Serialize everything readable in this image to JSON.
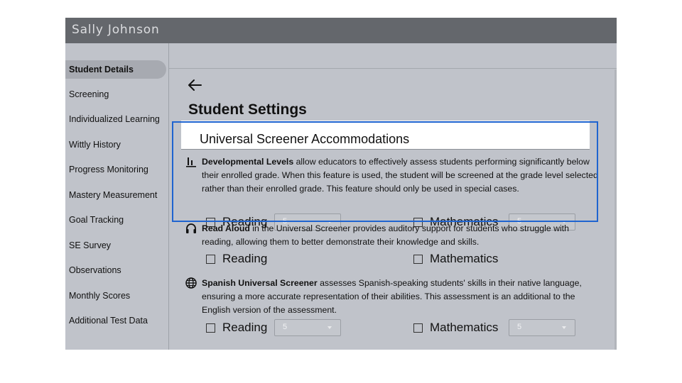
{
  "header": {
    "user_name": "Sally Johnson"
  },
  "sidebar": {
    "items": [
      {
        "label": "Student Details",
        "active": true
      },
      {
        "label": "Screening"
      },
      {
        "label": "Individualized Learning"
      },
      {
        "label": "Wittly History"
      },
      {
        "label": "Progress Monitoring"
      },
      {
        "label": "Mastery Measurement"
      },
      {
        "label": "Goal Tracking"
      },
      {
        "label": "SE Survey"
      },
      {
        "label": "Observations"
      },
      {
        "label": "Monthly Scores"
      },
      {
        "label": "Additional Test Data"
      }
    ]
  },
  "page": {
    "back_icon": "arrow-left-icon",
    "title": "Student Settings",
    "section_title": "Universal Screener Accommodations"
  },
  "accommodations": {
    "developmental": {
      "icon": "developmental-levels-icon",
      "name": "Developmental Levels",
      "text": " allow educators to effectively assess students performing significantly below their enrolled grade. When this feature is used, the student will be screened at the grade level selected rather than their enrolled grade. This feature should only be used in special cases.",
      "reading_label": "Reading",
      "reading_level": "5",
      "math_label": "Mathematics",
      "math_level": "5"
    },
    "read_aloud": {
      "icon": "headphones-icon",
      "name": "Read Aloud",
      "text": " in the Universal Screener provides auditory support for students who struggle with reading, allowing them to better demonstrate their knowledge and skills.",
      "reading_label": "Reading",
      "math_label": "Mathematics"
    },
    "spanish": {
      "icon": "globe-icon",
      "name": "Spanish Universal Screener",
      "text": " assesses Spanish-speaking students' skills in their native language, ensuring a more accurate representation of their abilities. This assessment is an additional to the English version of the assessment.",
      "reading_label": "Reading",
      "reading_level": "5",
      "math_label": "Mathematics",
      "math_level": "5"
    }
  },
  "colors": {
    "highlight_border": "#1f64d0",
    "titlebar": "#64676c",
    "background": "#c0c3ca"
  }
}
